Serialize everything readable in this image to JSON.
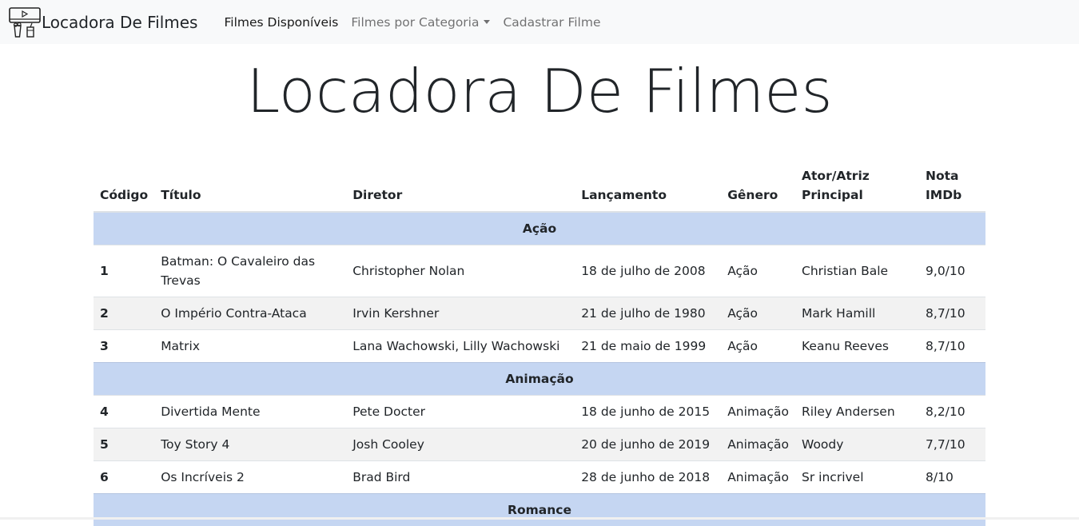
{
  "navbar": {
    "brand": "Locadora De Filmes",
    "brand_icon": "cinema-icon",
    "links": [
      "Filmes Disponíveis",
      "Filmes por Categoria",
      "Cadastrar Filme"
    ]
  },
  "page": {
    "title": "Locadora De Filmes"
  },
  "table": {
    "headers": [
      "Código",
      "Título",
      "Diretor",
      "Lançamento",
      "Gênero",
      "Ator/Atriz Principal",
      "Nota IMDb"
    ],
    "header_lines": {
      "ator_l1": "Ator/Atriz",
      "ator_l2": "Principal",
      "nota_l1": "Nota",
      "nota_l2": "IMDb"
    },
    "groups": [
      {
        "category": "Ação",
        "rows": [
          [
            "1",
            "Batman: O Cavaleiro das Trevas",
            "Christopher Nolan",
            "18 de julho de 2008",
            "Ação",
            "Christian Bale",
            "9,0/10"
          ],
          [
            "2",
            "O Império Contra-Ataca",
            "Irvin Kershner",
            "21 de julho de 1980",
            "Ação",
            "Mark Hamill",
            "8,7/10"
          ],
          [
            "3",
            "Matrix",
            "Lana Wachowski, Lilly Wachowski",
            "21 de maio de 1999",
            "Ação",
            "Keanu Reeves",
            "8,7/10"
          ]
        ]
      },
      {
        "category": "Animação",
        "rows": [
          [
            "4",
            "Divertida Mente",
            "Pete Docter",
            "18 de junho de 2015",
            "Animação",
            "Riley Andersen",
            "8,2/10"
          ],
          [
            "5",
            "Toy Story 4",
            "Josh Cooley",
            "20 de junho de 2019",
            "Animação",
            "Woody",
            "7,7/10"
          ],
          [
            "6",
            "Os Incríveis 2",
            "Brad Bird",
            "28 de junho de 2018",
            "Animação",
            "Sr incrivel",
            "8/10"
          ]
        ]
      },
      {
        "category": "Romance",
        "rows": []
      }
    ]
  }
}
